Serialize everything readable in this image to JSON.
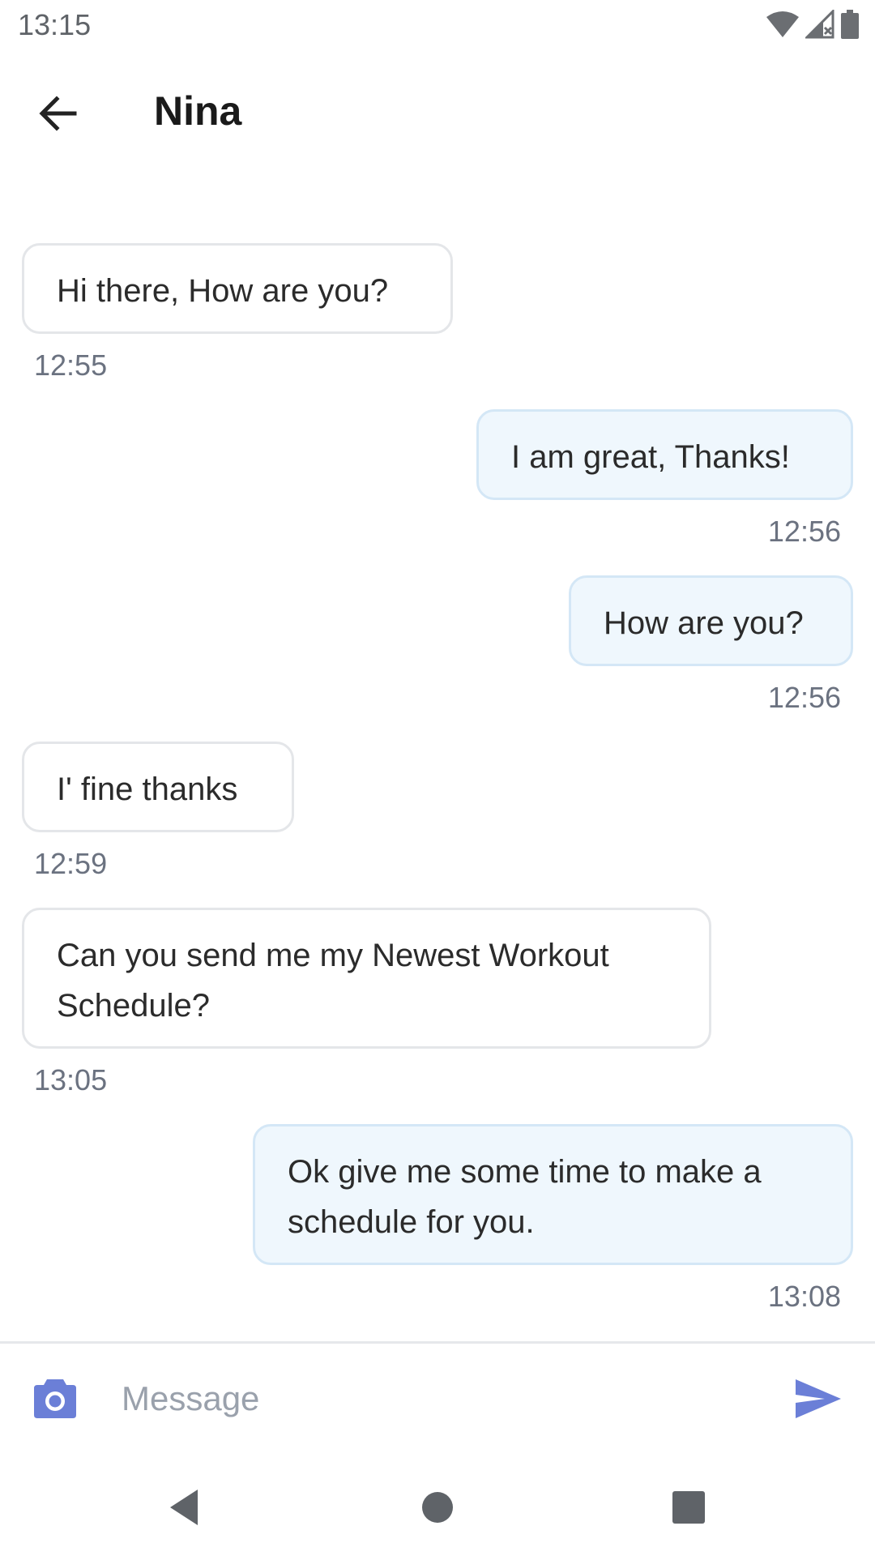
{
  "status_bar": {
    "time": "13:15",
    "icons": [
      "wifi-icon",
      "cell-signal-icon",
      "battery-icon"
    ]
  },
  "header": {
    "back_icon": "arrow-left-icon",
    "contact_name": "Nina"
  },
  "messages": [
    {
      "direction": "incoming",
      "text": "Hi there, How are you?",
      "time": "12:55"
    },
    {
      "direction": "outgoing",
      "text": "I am great, Thanks!",
      "time": "12:56"
    },
    {
      "direction": "outgoing",
      "text": "How are you?",
      "time": "12:56"
    },
    {
      "direction": "incoming",
      "text": "I' fine thanks",
      "time": "12:59"
    },
    {
      "direction": "incoming",
      "text": "Can you send me my Newest Workout Schedule?",
      "time": "13:05"
    },
    {
      "direction": "outgoing",
      "text": "Ok give me some time to make a schedule for you.",
      "time": "13:08"
    }
  ],
  "composer": {
    "camera_icon": "camera-icon",
    "placeholder": "Message",
    "value": "",
    "send_icon": "send-icon"
  },
  "nav_bar": {
    "icons": [
      "back-triangle-icon",
      "home-circle-icon",
      "recents-square-icon"
    ]
  },
  "colors": {
    "accent": "#6b7fd7",
    "outgoing_bubble": "#eff7fd",
    "incoming_border": "#e4e6e9",
    "timestamp": "#6b7280"
  }
}
